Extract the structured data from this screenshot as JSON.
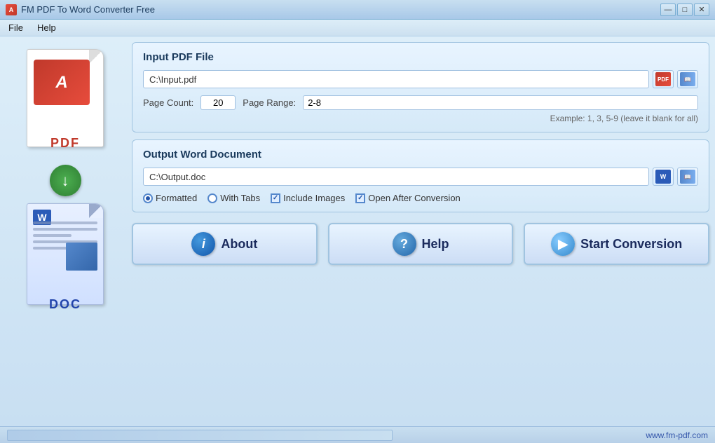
{
  "app": {
    "title": "FM PDF To Word Converter Free",
    "icon": "A"
  },
  "title_controls": {
    "minimize": "—",
    "maximize": "□",
    "close": "✕"
  },
  "menu": {
    "items": [
      "File",
      "Help"
    ]
  },
  "left_panel": {
    "pdf_label": "PDF",
    "doc_label": "DOC"
  },
  "input_section": {
    "title": "Input PDF File",
    "file_path": "C:\\Input.pdf",
    "page_count_label": "Page Count:",
    "page_count_value": "20",
    "page_range_label": "Page Range:",
    "page_range_value": "2-8",
    "example_text": "Example: 1, 3, 5-9  (leave it blank for all)"
  },
  "output_section": {
    "title": "Output Word Document",
    "file_path": "C:\\Output.doc",
    "options": {
      "formatted_label": "Formatted",
      "with_tabs_label": "With Tabs",
      "include_images_label": "Include Images",
      "open_after_label": "Open After Conversion"
    }
  },
  "buttons": {
    "about_label": "About",
    "help_label": "Help",
    "start_label": "Start Conversion"
  },
  "status_bar": {
    "website": "www.fm-pdf.com"
  }
}
